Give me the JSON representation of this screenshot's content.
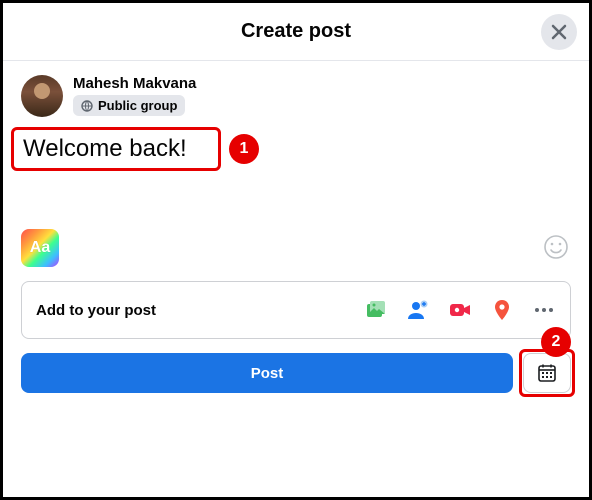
{
  "header": {
    "title": "Create post"
  },
  "author": {
    "name": "Mahesh Makvana",
    "privacy_label": "Public group"
  },
  "compose": {
    "text": "Welcome back!",
    "aa_label": "Aa"
  },
  "addbar": {
    "label": "Add to your post"
  },
  "footer": {
    "post_label": "Post"
  },
  "annotations": {
    "n1": "1",
    "n2": "2"
  }
}
